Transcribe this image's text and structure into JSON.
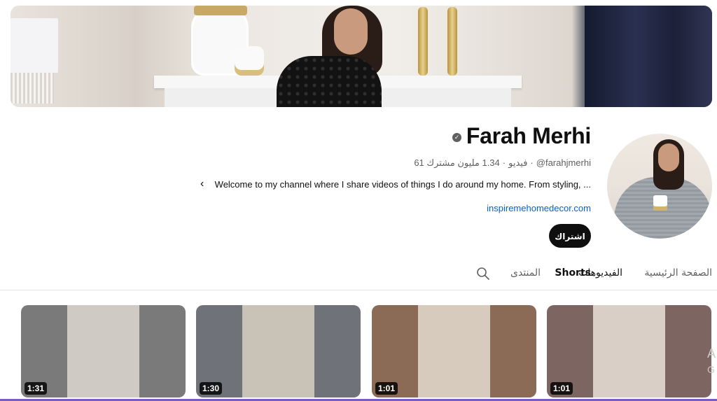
{
  "channel": {
    "name": "Farah Merhi",
    "handle": "@farahjmerhi",
    "subscribers": "1.34 مليون مشترك",
    "videos": "61 فيديو",
    "description": "Welcome to my channel where I share videos of things I do around my home. From styling, ...",
    "link": "inspiremehomedecor.com",
    "subscribe_label": "اشتراك",
    "verified_icon": "verified-check-icon"
  },
  "tabs": [
    {
      "label": "الصفحة الرئيسية",
      "active": false
    },
    {
      "label": "الفيديوهات",
      "active": false
    },
    {
      "label": "Shorts",
      "active": true
    },
    {
      "label": "المنتدى",
      "active": false
    }
  ],
  "shorts": [
    {
      "duration": "1:31",
      "colors": {
        "side": "#7a7a7a",
        "center": "#cfcac4"
      }
    },
    {
      "duration": "1:30",
      "colors": {
        "side": "#6f7379",
        "center": "#c9c2b6"
      }
    },
    {
      "duration": "1:01",
      "colors": {
        "side": "#8b6b55",
        "center": "#d6cbbd"
      }
    },
    {
      "duration": "1:01",
      "colors": {
        "side": "#7d6561",
        "center": "#d9cfc6"
      }
    }
  ],
  "watermark": {
    "line1": "A",
    "line2": "G"
  },
  "colors": {
    "accent": "#0f0f0f",
    "link": "#065fd4",
    "muted": "#606060"
  }
}
